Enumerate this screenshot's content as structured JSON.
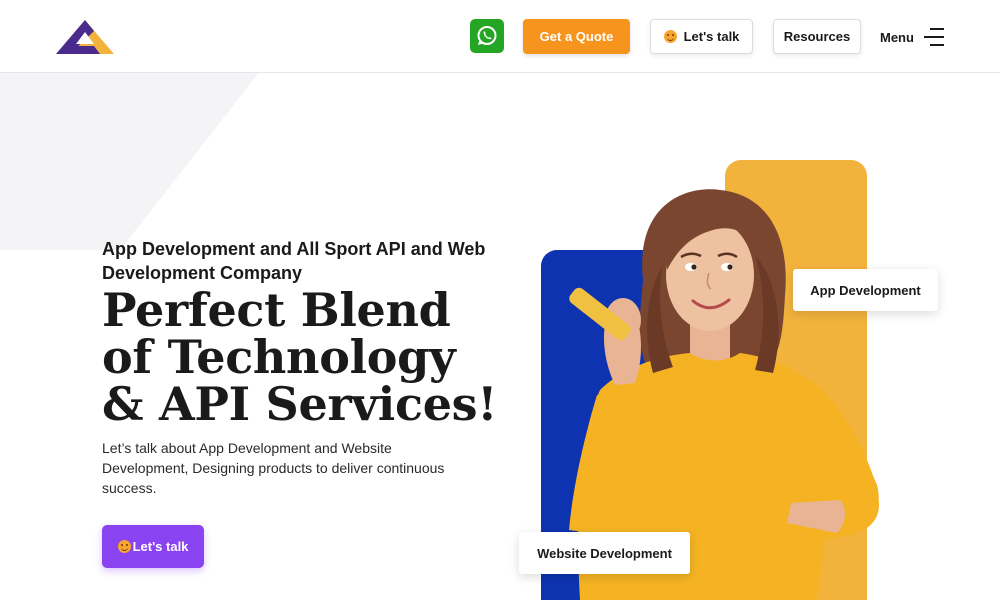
{
  "header": {
    "quote_label": "Get a Quote",
    "talk_label": "Let's talk",
    "resources_label": "Resources",
    "menu_label": "Menu"
  },
  "hero": {
    "subtitle": "App Development and All Sport API and Web Development Company",
    "headline_line1": "Perfect Blend",
    "headline_line2": "of Technology",
    "headline_line3": "& API Services!",
    "description": "Let’s talk about App Development and Website Development, Designing products to deliver continuous success.",
    "cta_label": "Let's talk"
  },
  "tags": {
    "app": "App Development",
    "web": "Website Development"
  },
  "colors": {
    "quote_orange": "#f7941d",
    "whatsapp_green": "#25a524",
    "cta_purple": "#8a43f0",
    "blue_block": "#0d33b0",
    "yellow_block": "#f2b33d",
    "shirt_yellow": "#f5b324",
    "logo_purple": "#4a2a8c",
    "logo_gold": "#f2b33d"
  },
  "icons": {
    "whatsapp": "whatsapp-icon",
    "smile": "smile-emoji-icon",
    "menu": "hamburger-menu-icon",
    "logo": "triangle-logo"
  }
}
